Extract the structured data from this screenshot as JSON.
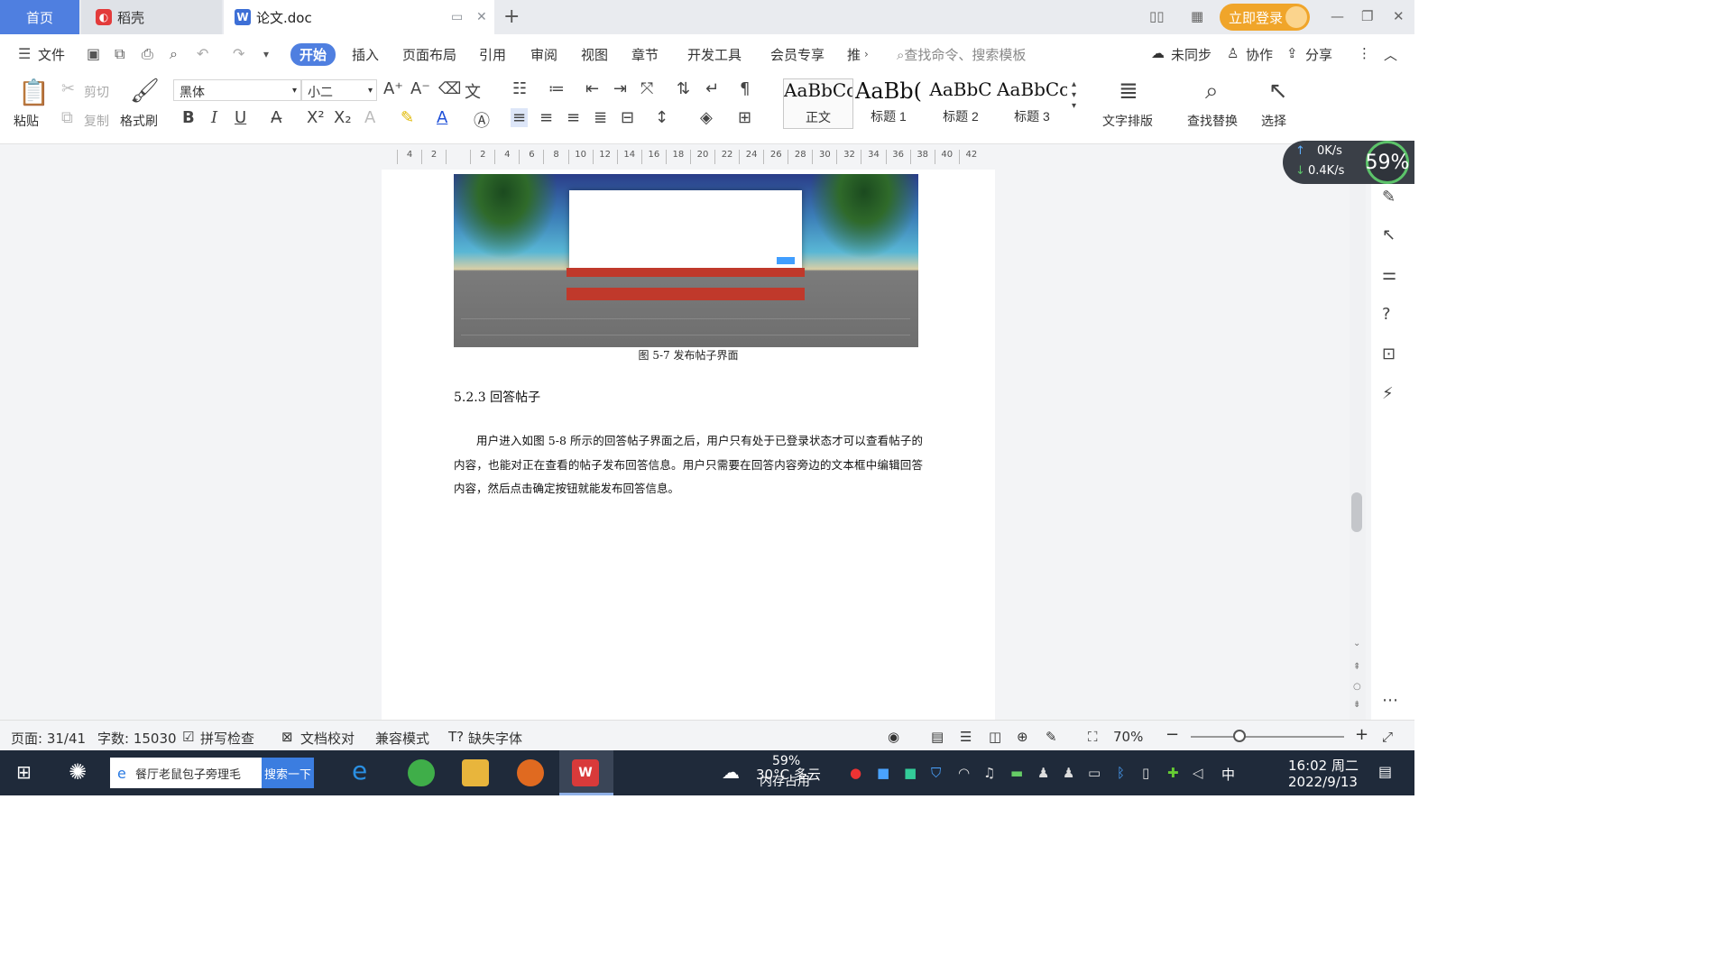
{
  "titlebar": {
    "tabs": [
      {
        "label": "首页"
      },
      {
        "label": "稻壳"
      },
      {
        "label": "论文.doc"
      }
    ],
    "login_label": "立即登录"
  },
  "menubar": {
    "file_label": "文件",
    "items": [
      "开始",
      "插入",
      "页面布局",
      "引用",
      "审阅",
      "视图",
      "章节",
      "开发工具",
      "会员专享",
      "推"
    ],
    "search_placeholder": "查找命令、搜索模板",
    "unsync_label": "未同步",
    "collab_label": "协作",
    "share_label": "分享"
  },
  "ribbon": {
    "paste_label": "粘贴",
    "cut_label": "剪切",
    "copy_label": "复制",
    "format_painter_label": "格式刷",
    "font_name": "黑体",
    "font_size": "小二",
    "styles": [
      {
        "sample": "AaBbCcI",
        "name": "正文"
      },
      {
        "sample": "AaBb(",
        "name": "标题 1"
      },
      {
        "sample": "AaBbC",
        "name": "标题 2"
      },
      {
        "sample": "AaBbCc",
        "name": "标题 3"
      }
    ],
    "text_layout_label": "文字排版",
    "find_replace_label": "查找替换",
    "select_label": "选择"
  },
  "ruler": {
    "ticks": [
      "4",
      "2",
      "",
      "2",
      "4",
      "6",
      "8",
      "10",
      "12",
      "14",
      "16",
      "18",
      "20",
      "22",
      "24",
      "26",
      "28",
      "30",
      "32",
      "34",
      "36",
      "38",
      "40",
      "42"
    ]
  },
  "document": {
    "figure_caption": "图 5-7  发布帖子界面",
    "section_heading": "5.2.3  回答帖子",
    "paragraph": "用户进入如图 5-8 所示的回答帖子界面之后，用户只有处于已登录状态才可以查看帖子的内容，也能对正在查看的帖子发布回答信息。用户只需要在回答内容旁边的文本框中编辑回答内容，然后点击确定按钮就能发布回答信息。"
  },
  "netwidget": {
    "up": "0K/s",
    "down": "0.4K/s",
    "percent": "59%"
  },
  "statusbar": {
    "page": "页面: 31/41",
    "words": "字数: 15030",
    "spellcheck": "拼写检查",
    "proofread": "文档校对",
    "compat": "兼容模式",
    "missing_font": "缺失字体",
    "zoom": "70%"
  },
  "taskbar": {
    "search_text": "餐厅老鼠包子旁理毛",
    "search_btn": "搜索一下",
    "weather": "30°C 多云",
    "mem_pct": "59%",
    "mem_label": "内存占用",
    "ime": "中",
    "time": "16:02 周二",
    "date": "2022/9/13"
  }
}
